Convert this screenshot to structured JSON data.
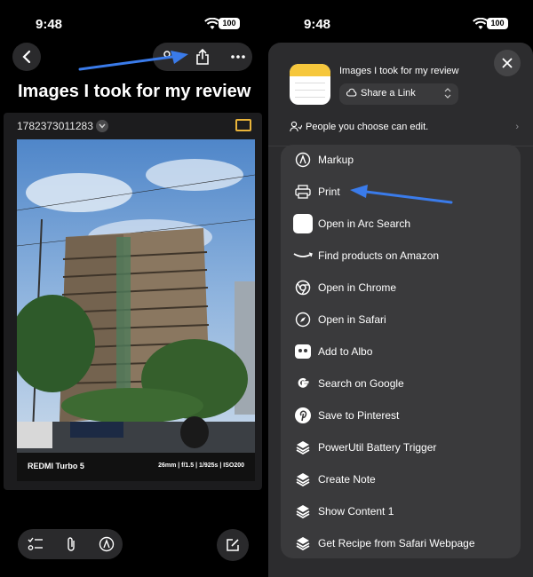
{
  "status_bar": {
    "time": "9:48",
    "battery": "100"
  },
  "left": {
    "title": "Images I took for my review",
    "photo": {
      "filename": "1782373011283",
      "device": "REDMI Turbo 5",
      "exif": "26mm  |  f/1.5  |  1/925s  |  ISO200"
    }
  },
  "right": {
    "status_bar": {
      "time": "9:48",
      "battery": "100"
    },
    "share_sheet": {
      "title": "Images I took for my review",
      "share_mode": "Share a Link",
      "permission": "People you choose can edit.",
      "actions": [
        {
          "label": "Markup",
          "icon": "markup-icon"
        },
        {
          "label": "Print",
          "icon": "printer-icon"
        },
        {
          "label": "Open in Arc Search",
          "icon": "arc-search-icon"
        },
        {
          "label": "Find products on Amazon",
          "icon": "amazon-icon"
        },
        {
          "label": "Open in Chrome",
          "icon": "chrome-icon"
        },
        {
          "label": "Open in Safari",
          "icon": "safari-icon"
        },
        {
          "label": "Add to Albo",
          "icon": "albo-icon"
        },
        {
          "label": "Search on Google",
          "icon": "google-icon"
        },
        {
          "label": "Save to Pinterest",
          "icon": "pinterest-icon"
        },
        {
          "label": "PowerUtil Battery Trigger",
          "icon": "shortcuts-icon"
        },
        {
          "label": "Create Note",
          "icon": "shortcuts-icon"
        },
        {
          "label": "Show Content 1",
          "icon": "shortcuts-icon"
        },
        {
          "label": "Get Recipe from Safari Webpage",
          "icon": "shortcuts-icon"
        }
      ]
    }
  },
  "colors": {
    "accent_arrow": "#3a7bea",
    "sheet_bg": "#2c2c2e",
    "row_bg": "#3a3a3c"
  }
}
